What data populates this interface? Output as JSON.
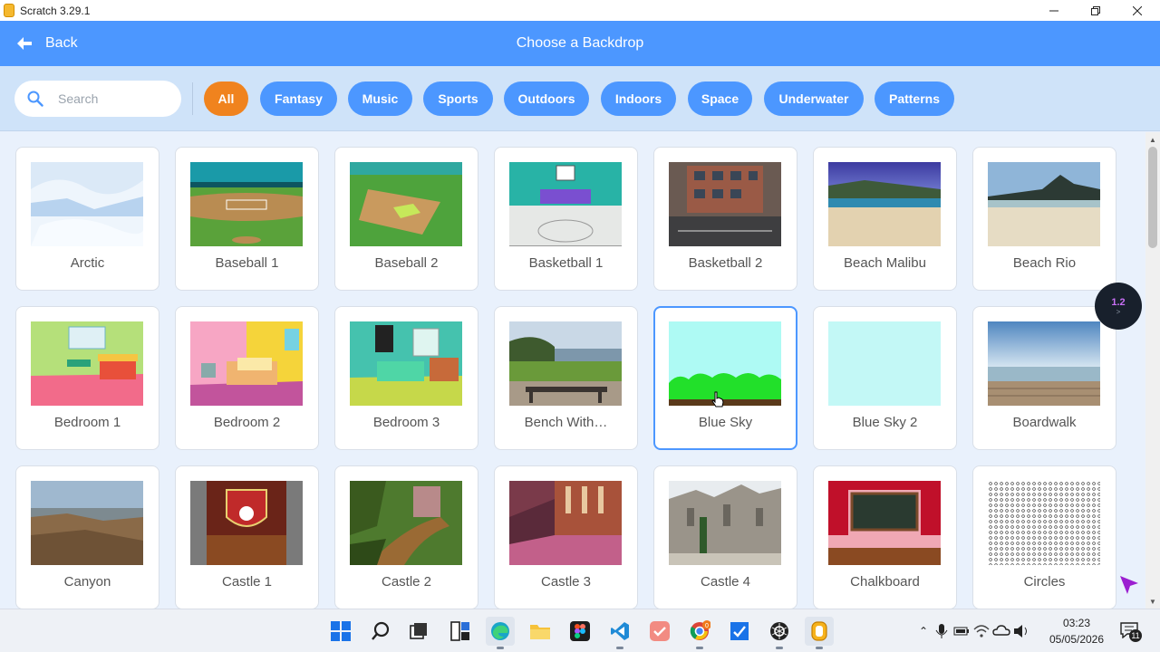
{
  "window": {
    "title": "Scratch 3.29.1"
  },
  "header": {
    "back_label": "Back",
    "title": "Choose a Backdrop"
  },
  "search": {
    "placeholder": "Search",
    "value": ""
  },
  "tags": [
    {
      "label": "All",
      "active": true
    },
    {
      "label": "Fantasy",
      "active": false
    },
    {
      "label": "Music",
      "active": false
    },
    {
      "label": "Sports",
      "active": false
    },
    {
      "label": "Outdoors",
      "active": false
    },
    {
      "label": "Indoors",
      "active": false
    },
    {
      "label": "Space",
      "active": false
    },
    {
      "label": "Underwater",
      "active": false
    },
    {
      "label": "Patterns",
      "active": false
    }
  ],
  "backdrops": [
    {
      "name": "Arctic"
    },
    {
      "name": "Baseball 1"
    },
    {
      "name": "Baseball 2"
    },
    {
      "name": "Basketball 1"
    },
    {
      "name": "Basketball 2"
    },
    {
      "name": "Beach Malibu"
    },
    {
      "name": "Beach Rio"
    },
    {
      "name": "Bedroom 1"
    },
    {
      "name": "Bedroom 2"
    },
    {
      "name": "Bedroom 3"
    },
    {
      "name": "Bench With…"
    },
    {
      "name": "Blue Sky",
      "selected": true
    },
    {
      "name": "Blue Sky 2"
    },
    {
      "name": "Boardwalk"
    },
    {
      "name": "Canyon"
    },
    {
      "name": "Castle 1"
    },
    {
      "name": "Castle 2"
    },
    {
      "name": "Castle 3"
    },
    {
      "name": "Castle 4"
    },
    {
      "name": "Chalkboard"
    },
    {
      "name": "Circles"
    }
  ],
  "floating_badge": {
    "version": "1.2",
    "sub": ">"
  },
  "taskbar": {
    "icons": [
      "windows-start-icon",
      "search-icon",
      "task-view-icon",
      "widgets-icon",
      "edge-icon",
      "file-explorer-icon",
      "figma-icon",
      "vscode-icon",
      "todo-icon",
      "chrome-icon",
      "tasks-icon",
      "chatgpt-icon",
      "scratch-icon"
    ],
    "chrome_badge": "0",
    "time": "03:23",
    "date": "05/05/2026",
    "notification_count": "11"
  },
  "colors": {
    "header_blue": "#4c97ff",
    "tag_active": "#f0831e",
    "filter_bg": "#cfe3f9",
    "grid_bg": "#e9f1fc"
  }
}
